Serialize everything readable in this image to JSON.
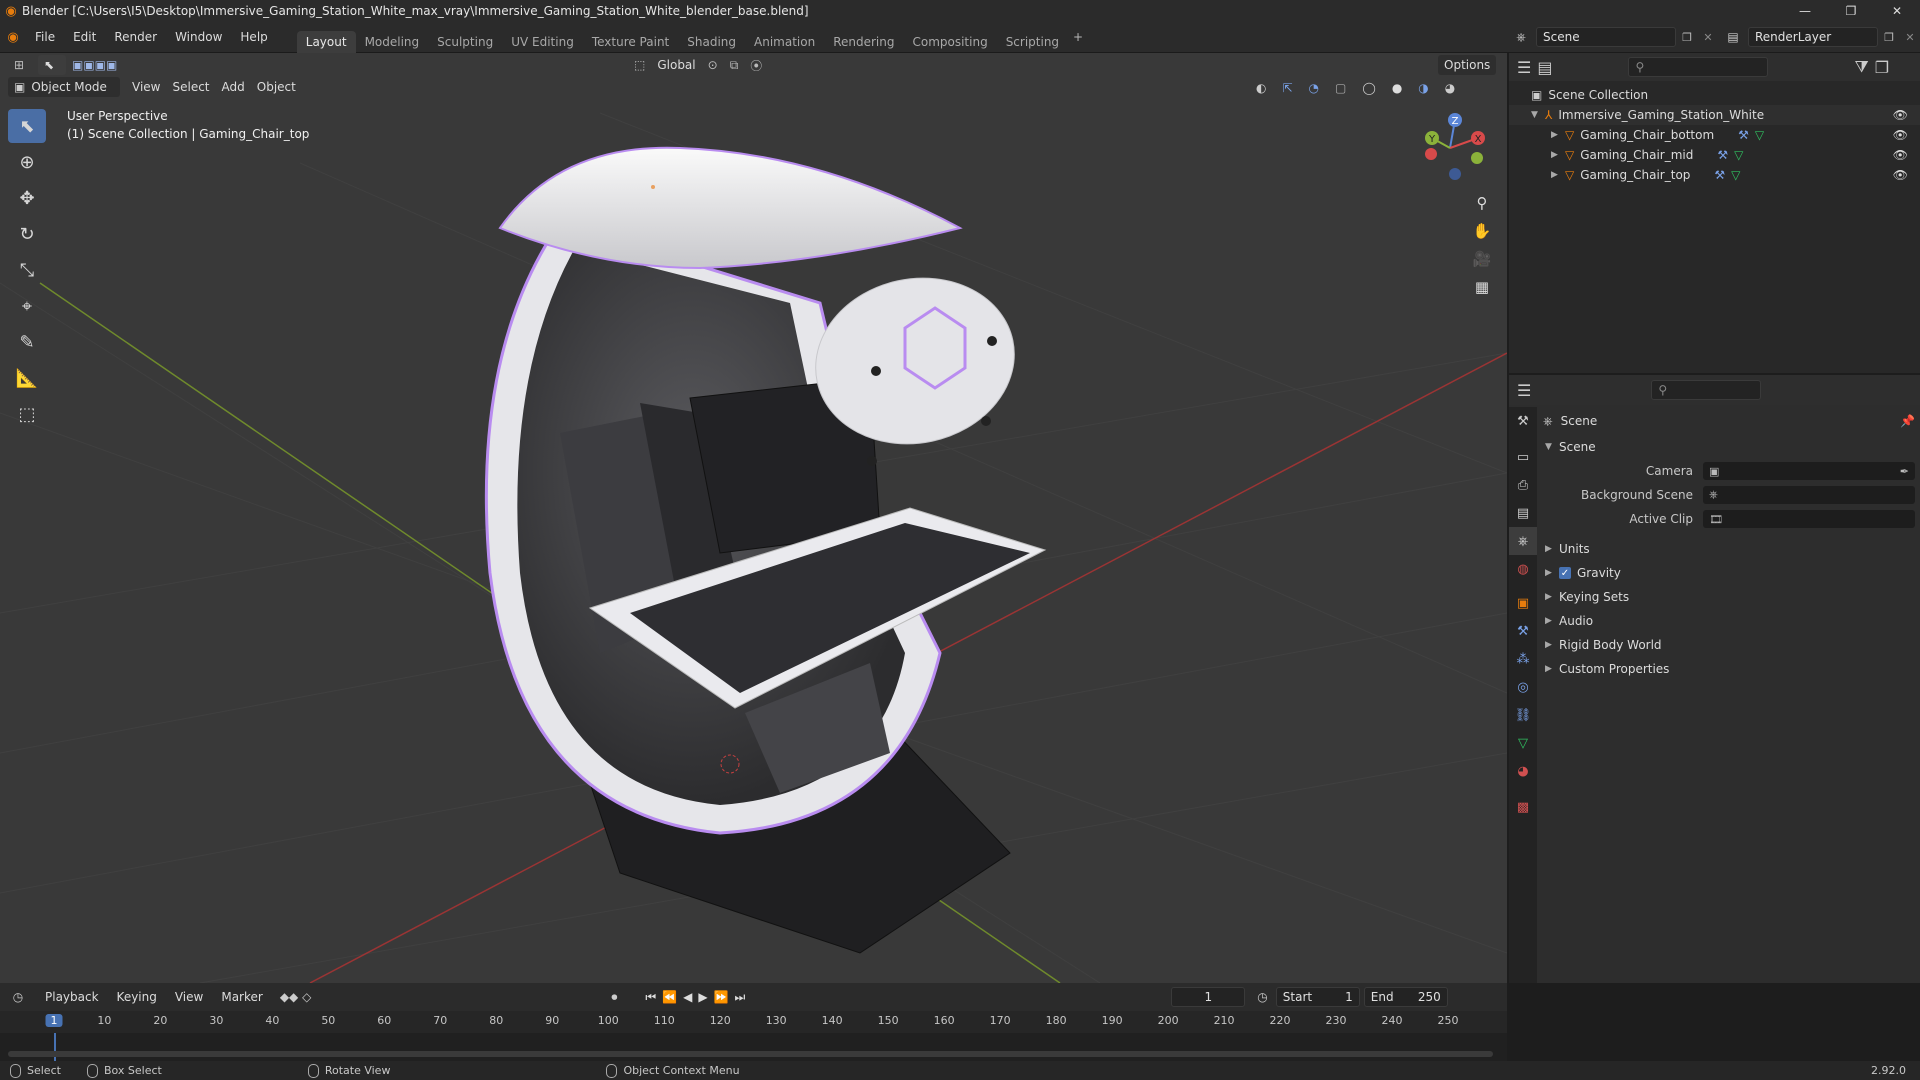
{
  "titlebar": {
    "title": "Blender [C:\\Users\\I5\\Desktop\\Immersive_Gaming_Station_White_max_vray\\Immersive_Gaming_Station_White_blender_base.blend]",
    "minimize": "—",
    "maximize": "❐",
    "close": "✕"
  },
  "menus": [
    "File",
    "Edit",
    "Render",
    "Window",
    "Help"
  ],
  "workspaces": [
    "Layout",
    "Modeling",
    "Sculpting",
    "UV Editing",
    "Texture Paint",
    "Shading",
    "Animation",
    "Rendering",
    "Compositing",
    "Scripting"
  ],
  "scene_field": "Scene",
  "renderlayer_field": "RenderLayer",
  "viewport": {
    "mode": "Object Mode",
    "menus": [
      "View",
      "Select",
      "Add",
      "Object"
    ],
    "orientation": "Global",
    "options": "Options",
    "perspective": "User Perspective",
    "collection_info": "(1) Scene Collection | Gaming_Chair_top",
    "gizmo": {
      "z": "Z",
      "y": "Y",
      "x": "X"
    }
  },
  "outliner": {
    "root": "Scene Collection",
    "collection": "Immersive_Gaming_Station_White",
    "objects": [
      "Gaming_Chair_bottom",
      "Gaming_Chair_mid",
      "Gaming_Chair_top"
    ]
  },
  "properties": {
    "header": "Scene",
    "panel": "Scene",
    "fields": [
      {
        "label": "Camera"
      },
      {
        "label": "Background Scene"
      },
      {
        "label": "Active Clip"
      }
    ],
    "subpanels": [
      "Units",
      "Gravity",
      "Keying Sets",
      "Audio",
      "Rigid Body World",
      "Custom Properties"
    ]
  },
  "timeline": {
    "menus": [
      "Playback",
      "Keying",
      "View",
      "Marker"
    ],
    "current_frame": "1",
    "start_label": "Start",
    "start": "1",
    "end_label": "End",
    "end": "250",
    "ruler": [
      "1",
      "10",
      "20",
      "30",
      "40",
      "50",
      "60",
      "70",
      "80",
      "90",
      "100",
      "110",
      "120",
      "130",
      "140",
      "150",
      "160",
      "170",
      "180",
      "190",
      "200",
      "210",
      "220",
      "230",
      "240",
      "250"
    ]
  },
  "statusbar": {
    "select": "Select",
    "box_select": "Box Select",
    "rotate": "Rotate View",
    "context": "Object Context Menu",
    "version": "2.92.0"
  },
  "colors": {
    "accent": "#4772b3",
    "orange": "#e87d0d",
    "bg": "#393939"
  }
}
